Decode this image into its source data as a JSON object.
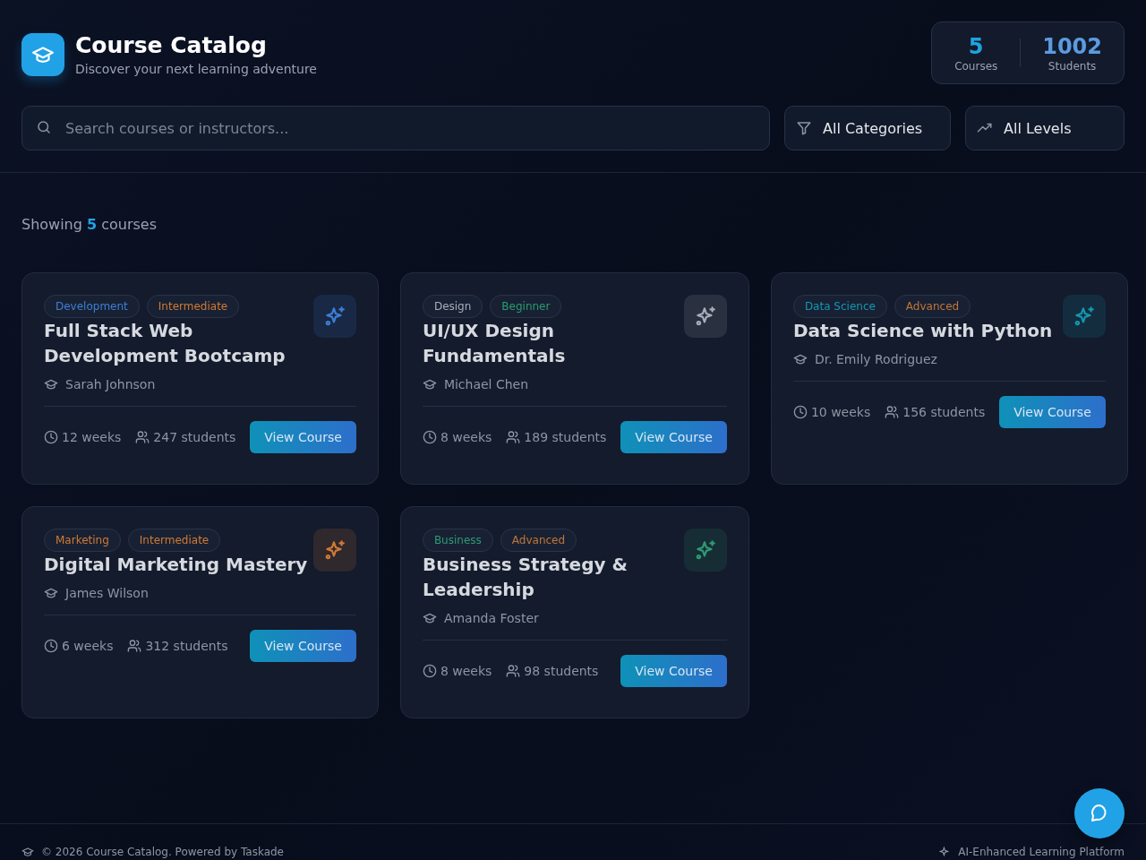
{
  "header": {
    "title": "Course Catalog",
    "subtitle": "Discover your next learning adventure"
  },
  "stats": [
    {
      "value": "5",
      "label": "Courses",
      "color": "#1fa3e0"
    },
    {
      "value": "1002",
      "label": "Students",
      "color": "#5b9be0"
    }
  ],
  "search": {
    "placeholder": "Search courses or instructors..."
  },
  "filters": [
    {
      "kind": "category",
      "label": "All Categories"
    },
    {
      "kind": "level",
      "label": "All Levels"
    }
  ],
  "showing": "Showing **5** courses",
  "courses": [
    {
      "tags": [
        {
          "label": "Development",
          "color": "#3d7fd6"
        },
        {
          "label": "Intermediate",
          "color": "#d07a34"
        }
      ],
      "title": "Full Stack Web Development Bootcamp",
      "instructor": "Sarah Johnson",
      "duration": "12 weeks",
      "students": "247 students",
      "action": "View Course"
    },
    {
      "tags": [
        {
          "label": "Design",
          "color": "#a8adb8"
        },
        {
          "label": "Beginner",
          "color": "#2a9d6e"
        }
      ],
      "title": "UI/UX Design Fundamentals",
      "instructor": "Michael Chen",
      "duration": "8 weeks",
      "students": "189 students",
      "action": "View Course"
    },
    {
      "tags": [
        {
          "label": "Data Science",
          "color": "#1497b0"
        },
        {
          "label": "Advanced",
          "color": "#c0763a"
        }
      ],
      "title": "Data Science with Python",
      "instructor": "Dr. Emily Rodriguez",
      "duration": "10 weeks",
      "students": "156 students",
      "action": "View Course"
    },
    {
      "tags": [
        {
          "label": "Marketing",
          "color": "#d07a34"
        },
        {
          "label": "Intermediate",
          "color": "#d07a34"
        }
      ],
      "title": "Digital Marketing Mastery",
      "instructor": "James Wilson",
      "duration": "6 weeks",
      "students": "312 students",
      "action": "View Course"
    },
    {
      "tags": [
        {
          "label": "Business",
          "color": "#2f9a72"
        },
        {
          "label": "Advanced",
          "color": "#c0763a"
        }
      ],
      "title": "Business Strategy & Leadership",
      "instructor": "Amanda Foster",
      "duration": "8 weeks",
      "students": "98 students",
      "action": "View Course"
    }
  ],
  "footer": {
    "copyright": "© 2026 Course Catalog. Powered by Taskade",
    "tagline": "AI-Enhanced Learning Platform"
  }
}
